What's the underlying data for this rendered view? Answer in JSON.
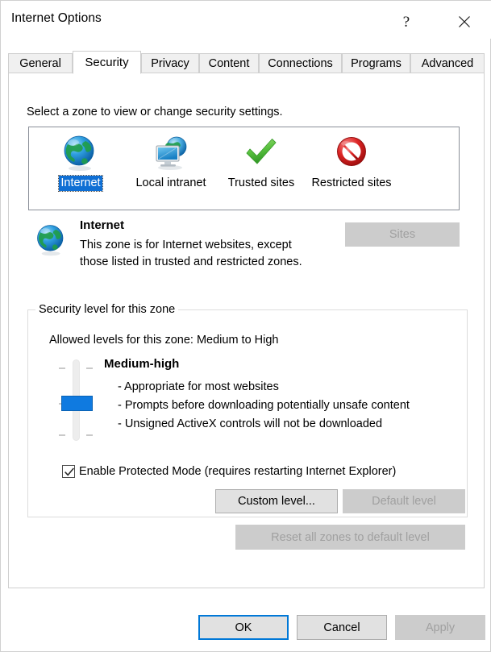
{
  "window": {
    "title": "Internet Options",
    "help_icon": "question-mark-icon",
    "close_icon": "close-icon"
  },
  "tabs": [
    {
      "label": "General",
      "active": false
    },
    {
      "label": "Security",
      "active": true
    },
    {
      "label": "Privacy",
      "active": false
    },
    {
      "label": "Content",
      "active": false
    },
    {
      "label": "Connections",
      "active": false
    },
    {
      "label": "Programs",
      "active": false
    },
    {
      "label": "Advanced",
      "active": false
    }
  ],
  "security_tab": {
    "select_zone_label": "Select a zone to view or change security settings.",
    "zones": [
      {
        "label": "Internet",
        "icon": "globe-icon",
        "selected": true
      },
      {
        "label": "Local intranet",
        "icon": "monitor-globe-icon",
        "selected": false
      },
      {
        "label": "Trusted sites",
        "icon": "green-checkmark-icon",
        "selected": false
      },
      {
        "label": "Restricted sites",
        "icon": "red-prohibition-icon",
        "selected": false
      }
    ],
    "zone_description": {
      "icon": "globe-icon",
      "title": "Internet",
      "body": "This zone is for Internet websites, except those listed in trusted and restricted zones."
    },
    "sites_button": {
      "label": "Sites",
      "enabled": false
    },
    "security_level": {
      "legend": "Security level for this zone",
      "allowed_levels": "Allowed levels for this zone: Medium to High",
      "level_name": "Medium-high",
      "bullets": [
        "- Appropriate for most websites",
        "- Prompts before downloading potentially unsafe content",
        "- Unsigned ActiveX controls will not be downloaded"
      ],
      "slider": {
        "position_percent": 50,
        "thumb_color": "#0f7ae0"
      },
      "protected_mode": {
        "label": "Enable Protected Mode (requires restarting Internet Explorer)",
        "checked": true
      },
      "custom_level_button": {
        "label": "Custom level...",
        "enabled": true
      },
      "default_level_button": {
        "label": "Default level",
        "enabled": false
      }
    },
    "reset_button": {
      "label": "Reset all zones to default level",
      "enabled": false
    }
  },
  "footer": {
    "ok": {
      "label": "OK",
      "enabled": true,
      "focused": true
    },
    "cancel": {
      "label": "Cancel",
      "enabled": true,
      "focused": false
    },
    "apply": {
      "label": "Apply",
      "enabled": false,
      "focused": false
    }
  },
  "colors": {
    "selection_blue": "#0f6fd4",
    "focus_blue": "#0078d7",
    "slider_blue": "#0f7ae0",
    "disabled_bg": "#cccccc",
    "disabled_text": "#a0a0a0",
    "button_bg": "#e1e1e1",
    "dialog_bg": "#ffffff"
  }
}
